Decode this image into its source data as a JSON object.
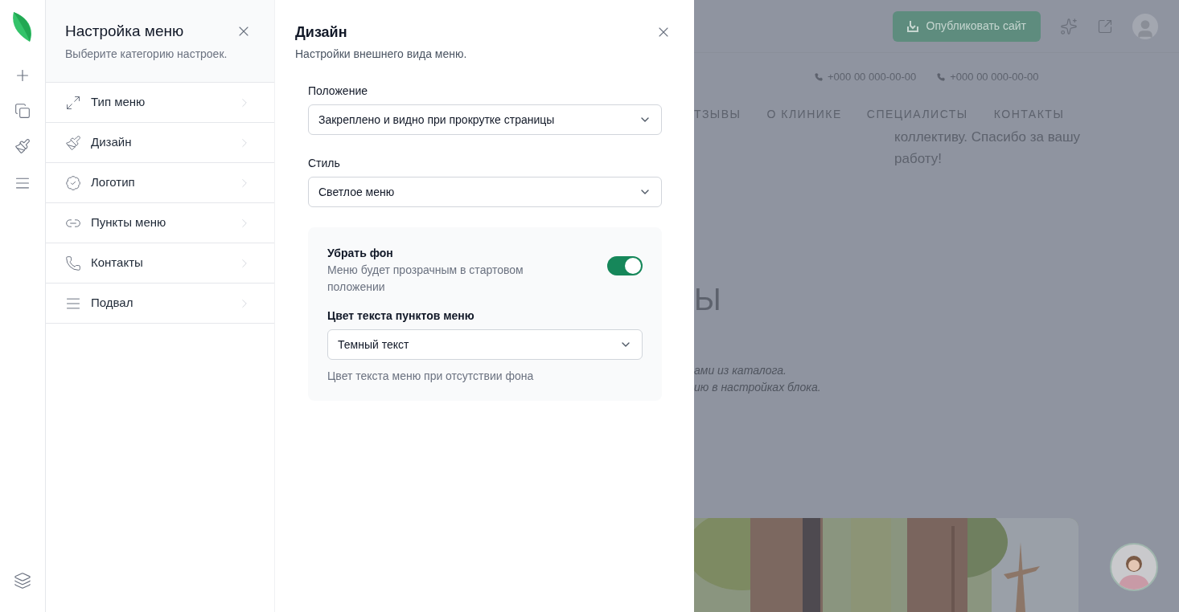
{
  "menu_panel": {
    "title": "Настройка меню",
    "subtitle": "Выберите категорию настроек.",
    "items": [
      {
        "label": "Тип меню",
        "kind": "expand"
      },
      {
        "label": "Дизайн",
        "kind": "brush"
      },
      {
        "label": "Логотип",
        "kind": "badge"
      },
      {
        "label": "Пункты меню",
        "kind": "link"
      },
      {
        "label": "Контакты",
        "kind": "phone"
      },
      {
        "label": "Подвал",
        "kind": "lines"
      }
    ]
  },
  "design_panel": {
    "title": "Дизайн",
    "subtitle": "Настройки внешнего вида меню.",
    "fields": [
      {
        "label": "Положение",
        "value": "Закреплено и видно при прокрутке страницы"
      },
      {
        "label": "Стиль",
        "value": "Светлое меню"
      }
    ],
    "background_card": {
      "toggle": {
        "label": "Убрать фон",
        "description": "Меню будет прозрачным в стартовом положении",
        "on": true
      },
      "select": {
        "label": "Цвет текста пунктов меню",
        "value": "Темный текст",
        "hint": "Цвет текста меню при отсутствии фона"
      }
    }
  },
  "preview": {
    "publish_button": "Опубликовать сайт",
    "phones": [
      "+000 00 000-00-00",
      "+000 00 000-00-00"
    ],
    "nav": [
      "ТЗЫВЫ",
      "О КЛИНИКЕ",
      "СПЕЦИАЛИСТЫ",
      "КОНТАКТЫ"
    ],
    "review_text": "коллективу. Спасибо за вашу работу!",
    "heading": "Ы",
    "notes": [
      "ами из каталога.",
      "ию в настройках блока."
    ]
  }
}
